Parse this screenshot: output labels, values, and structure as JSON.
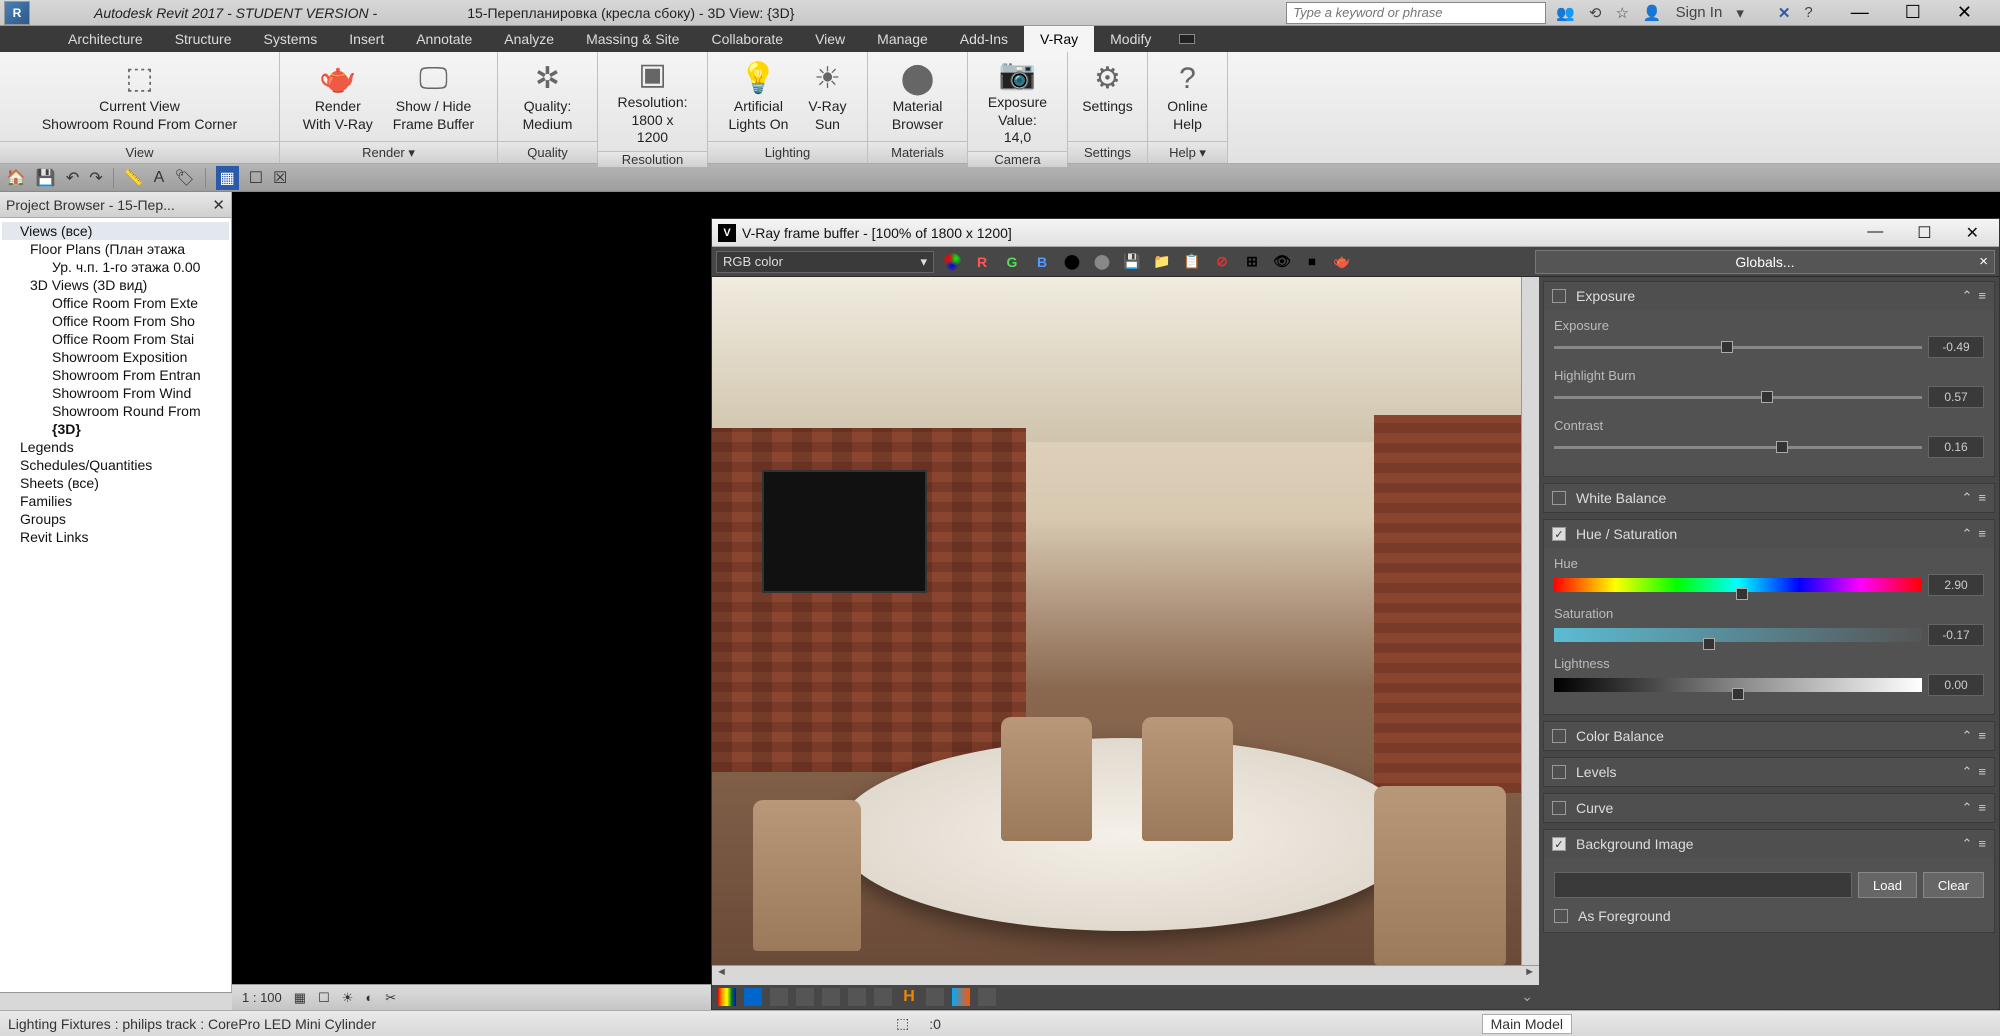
{
  "window": {
    "app_title": "Autodesk Revit 2017 - STUDENT VERSION -",
    "doc_title": "15-Перепланировка (кресла сбоку) - 3D View: {3D}",
    "search_placeholder": "Type a keyword or phrase",
    "sign_in": "Sign In"
  },
  "menu": [
    "Architecture",
    "Structure",
    "Systems",
    "Insert",
    "Annotate",
    "Analyze",
    "Massing & Site",
    "Collaborate",
    "View",
    "Manage",
    "Add-Ins",
    "V-Ray",
    "Modify"
  ],
  "menu_active": "V-Ray",
  "ribbon": {
    "view": {
      "label": "View",
      "btn_l1": "Current View",
      "btn_l2": "Showroom Round From Corner"
    },
    "render": {
      "label": "Render ▾",
      "btn1_l1": "Render",
      "btn1_l2": "With V-Ray",
      "btn2_l1": "Show / Hide",
      "btn2_l2": "Frame Buffer"
    },
    "quality": {
      "label": "Quality",
      "l1": "Quality:",
      "l2": "Medium"
    },
    "resolution": {
      "label": "Resolution",
      "l1": "Resolution:",
      "l2": "1800 x 1200"
    },
    "lighting": {
      "label": "Lighting",
      "btn1_l1": "Artificial",
      "btn1_l2": "Lights On",
      "btn2_l1": "V-Ray",
      "btn2_l2": "Sun"
    },
    "materials": {
      "label": "Materials",
      "l1": "Material",
      "l2": "Browser"
    },
    "camera": {
      "label": "Camera",
      "l1": "Exposure",
      "l2": "Value: 14,0"
    },
    "settings": {
      "label": "Settings",
      "l1": "Settings"
    },
    "help": {
      "label": "Help ▾",
      "l1": "Online",
      "l2": "Help"
    }
  },
  "project_browser": {
    "title": "Project Browser - 15-Пер...",
    "tree": [
      {
        "t": "Views (все)",
        "lvl": 0,
        "sel": true
      },
      {
        "t": "Floor Plans (План этажа",
        "lvl": 1
      },
      {
        "t": "Ур. ч.п. 1-го этажа 0.00",
        "lvl": 2
      },
      {
        "t": "3D Views (3D вид)",
        "lvl": 1
      },
      {
        "t": "Office Room From Exte",
        "lvl": 2
      },
      {
        "t": "Office Room From Sho",
        "lvl": 2
      },
      {
        "t": "Office Room From Stai",
        "lvl": 2
      },
      {
        "t": "Showroom Exposition",
        "lvl": 2
      },
      {
        "t": "Showroom From Entran",
        "lvl": 2
      },
      {
        "t": "Showroom From Wind",
        "lvl": 2
      },
      {
        "t": "Showroom Round From",
        "lvl": 2
      },
      {
        "t": "{3D}",
        "lvl": 2,
        "bold": true
      },
      {
        "t": "Legends",
        "lvl": 0
      },
      {
        "t": "Schedules/Quantities",
        "lvl": 0
      },
      {
        "t": "Sheets (все)",
        "lvl": 0
      },
      {
        "t": "Families",
        "lvl": 0
      },
      {
        "t": "Groups",
        "lvl": 0
      },
      {
        "t": "Revit Links",
        "lvl": 0
      }
    ]
  },
  "view_scale": "1 : 100",
  "vfb": {
    "title": "V-Ray frame buffer - [100% of 1800 x 1200]",
    "channel_combo": "RGB color",
    "channels": {
      "r": "R",
      "g": "G",
      "b": "B"
    },
    "globals_btn": "Globals...",
    "panel": {
      "exposure": {
        "title": "Exposure",
        "exposure": {
          "label": "Exposure",
          "val": "-0.49"
        },
        "highlight": {
          "label": "Highlight Burn",
          "val": "0.57"
        },
        "contrast": {
          "label": "Contrast",
          "val": "0.16"
        }
      },
      "white_balance": "White Balance",
      "hue_sat": {
        "title": "Hue / Saturation",
        "hue": {
          "label": "Hue",
          "val": "2.90"
        },
        "sat": {
          "label": "Saturation",
          "val": "-0.17"
        },
        "light": {
          "label": "Lightness",
          "val": "0.00"
        }
      },
      "color_balance": "Color Balance",
      "levels": "Levels",
      "curve": "Curve",
      "bg_image": {
        "title": "Background Image",
        "load": "Load",
        "clear": "Clear",
        "as_fg": "As Foreground"
      }
    }
  },
  "status": {
    "text": "Lighting Fixtures : philips track : CorePro LED Mini Cylinder",
    "zero": ":0",
    "main_model": "Main Model"
  }
}
